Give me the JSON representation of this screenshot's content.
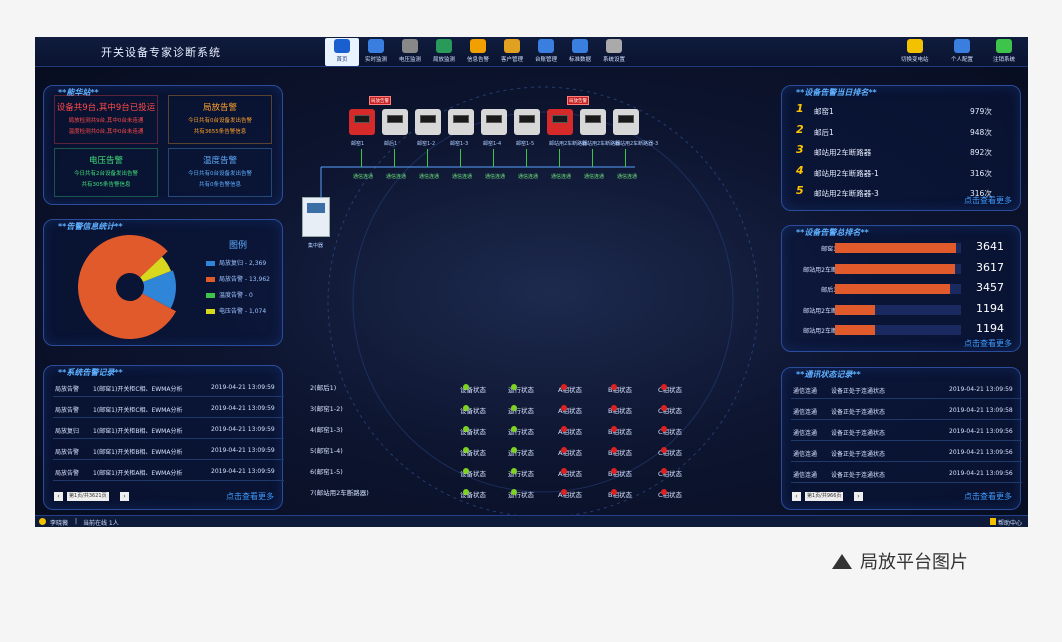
{
  "app_title": "开关设备专家诊断系统",
  "nav": [
    {
      "label": "首页",
      "icon": "home-icon",
      "active": true
    },
    {
      "label": "实时监测",
      "icon": "monitor-icon"
    },
    {
      "label": "电压监测",
      "icon": "gauge-icon"
    },
    {
      "label": "局放监测",
      "icon": "screen-icon"
    },
    {
      "label": "信息告警",
      "icon": "alert-icon"
    },
    {
      "label": "客户管理",
      "icon": "users-icon"
    },
    {
      "label": "台账管理",
      "icon": "ledger-icon"
    },
    {
      "label": "标准数据",
      "icon": "database-icon"
    },
    {
      "label": "系统设置",
      "icon": "settings-icon"
    }
  ],
  "right_nav": [
    {
      "label": "切换变电站",
      "icon": "switch-icon"
    },
    {
      "label": "个人配置",
      "icon": "user-icon"
    },
    {
      "label": "注销系统",
      "icon": "logout-icon"
    }
  ],
  "station": {
    "title": "**能华站**",
    "boxes": [
      {
        "title": "设备共9台,其中9台已投运",
        "lines": [
          "局放检测共9台,其中0台未连通",
          "温度检测共0台,其中0台未连通"
        ],
        "color": "#ff4a4a"
      },
      {
        "title": "局放告警",
        "lines": [
          "今日共有0台设备发出告警",
          "共有3655条告警信息"
        ],
        "color": "#ffa12a"
      },
      {
        "title": "电压告警",
        "lines": [
          "今日共有2台设备发出告警",
          "共有305条告警信息"
        ],
        "color": "#3fe07a"
      },
      {
        "title": "温度告警",
        "lines": [
          "今日共有0台设备发出告警",
          "共有0条告警信息"
        ],
        "color": "#5fb0ff"
      }
    ]
  },
  "alarm_stats": {
    "title": "**告警信息统计**",
    "legend_title": "图例",
    "legend": [
      {
        "label": "局放复归 - 2,369",
        "color": "#2f86d8",
        "value": 2369
      },
      {
        "label": "局放告警 - 13,962",
        "color": "#e05a2c",
        "value": 13962
      },
      {
        "label": "温度告警 - 0",
        "color": "#3ec44a",
        "value": 0
      },
      {
        "label": "电压告警 - 1,074",
        "color": "#d8d81e",
        "value": 1074
      }
    ]
  },
  "sys_records": {
    "title": "**系统告警记录**",
    "rows": [
      {
        "type": "局放告警",
        "desc": "1(邮窑1)开关柜C相、EWMA分析",
        "time": "2019-04-21 13:09:59"
      },
      {
        "type": "局放告警",
        "desc": "1(邮窑1)开关柜C相、EWMA分析",
        "time": "2019-04-21 13:09:59"
      },
      {
        "type": "局放复归",
        "desc": "1(邮窑1)开关柜B相、EWMA分析",
        "time": "2019-04-21 13:09:59"
      },
      {
        "type": "局放告警",
        "desc": "1(邮窑1)开关柜B相、EWMA分析",
        "time": "2019-04-21 13:09:59"
      },
      {
        "type": "局放告警",
        "desc": "1(邮窑1)开关柜A相、EWMA分析",
        "time": "2019-04-21 13:09:59"
      }
    ],
    "pager": "第1页/共3621页",
    "more": "点击查看更多"
  },
  "devices": [
    {
      "label": "邮窑1",
      "color": "#d62a2a",
      "alarm": true
    },
    {
      "label": "邮后1",
      "color": "#d8d8d8",
      "alarm": false
    },
    {
      "label": "邮窑1-2",
      "color": "#d8d8d8",
      "alarm": false
    },
    {
      "label": "邮窑1-3",
      "color": "#d8d8d8",
      "alarm": false
    },
    {
      "label": "邮窑1-4",
      "color": "#d8d8d8",
      "alarm": false
    },
    {
      "label": "邮窑1-5",
      "color": "#d8d8d8",
      "alarm": false
    },
    {
      "label": "邮站用2车断路器",
      "color": "#d62a2a",
      "alarm": true
    },
    {
      "label": "邮站用2车断路器",
      "color": "#d8d8d8",
      "alarm": false
    },
    {
      "label": "邮站用2车断路器-3",
      "color": "#d8d8d8",
      "alarm": false
    }
  ],
  "device_alarm_label": "局放告警",
  "device_status": "通信连通",
  "concentrator_label": "集中器",
  "states": {
    "rows": [
      {
        "name": "2(邮后1)"
      },
      {
        "name": "3(邮窑1-2)"
      },
      {
        "name": "4(邮窑1-3)"
      },
      {
        "name": "5(邮窑1-4)"
      },
      {
        "name": "6(邮窑1-5)"
      },
      {
        "name": "7(邮站用2车断路器)"
      }
    ],
    "labels": [
      "设备状态",
      "运行状态",
      "A相状态",
      "B相状态",
      "C相状态"
    ],
    "dot_colors": [
      "#7ed321",
      "#7ed321",
      "#e02020",
      "#e02020",
      "#e02020"
    ]
  },
  "today_rank": {
    "title": "**设备告警当日排名**",
    "items": [
      {
        "rank": "1",
        "name": "邮窑1",
        "count": "979次"
      },
      {
        "rank": "2",
        "name": "邮后1",
        "count": "948次"
      },
      {
        "rank": "3",
        "name": "邮站用2车断路器",
        "count": "892次"
      },
      {
        "rank": "4",
        "name": "邮站用2车断路器-1",
        "count": "316次"
      },
      {
        "rank": "5",
        "name": "邮站用2车断路器-3",
        "count": "316次"
      }
    ],
    "more": "点击查看更多"
  },
  "total_rank": {
    "title": "**设备告警总排名**",
    "items": [
      {
        "name": "邮窑1",
        "value": "3641",
        "num": 3641
      },
      {
        "name": "邮站用2车断",
        "value": "3617",
        "num": 3617
      },
      {
        "name": "邮后1",
        "value": "3457",
        "num": 3457
      },
      {
        "name": "邮站用2车断",
        "value": "1194",
        "num": 1194
      },
      {
        "name": "邮站用2车断",
        "value": "1194",
        "num": 1194
      }
    ],
    "max": 3800,
    "more": "点击查看更多"
  },
  "comm_records": {
    "title": "**通讯状态记录**",
    "rows": [
      {
        "type": "通信连通",
        "desc": "设备正处于连通状态",
        "time": "2019-04-21 13:09:59"
      },
      {
        "type": "通信连通",
        "desc": "设备正处于连通状态",
        "time": "2019-04-21 13:09:58"
      },
      {
        "type": "通信连通",
        "desc": "设备正处于连通状态",
        "time": "2019-04-21 13:09:56"
      },
      {
        "type": "通信连通",
        "desc": "设备正处于连通状态",
        "time": "2019-04-21 13:09:56"
      },
      {
        "type": "通信连通",
        "desc": "设备正处于连通状态",
        "time": "2019-04-21 13:09:56"
      }
    ],
    "pager": "第1页/共966页",
    "more": "点击查看更多"
  },
  "bottom": {
    "user": "李晓薇",
    "online": "当前在线 1人",
    "help": "帮助中心"
  },
  "caption": "局放平台图片"
}
